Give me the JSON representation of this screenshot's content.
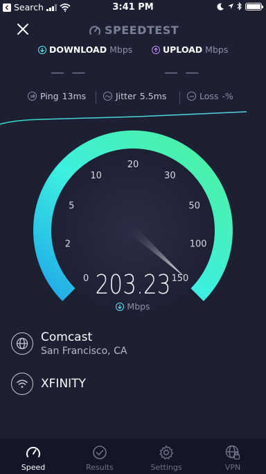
{
  "status_bar": {
    "back_label": "Search",
    "time": "3:41 PM"
  },
  "app": {
    "brand": "SPEEDTEST"
  },
  "download": {
    "label": "DOWNLOAD",
    "unit": "Mbps",
    "value": "— —",
    "color": "#5ee6f5"
  },
  "upload": {
    "label": "UPLOAD",
    "unit": "Mbps",
    "value": "— —",
    "color": "#c08cf5"
  },
  "stats": {
    "ping_label": "Ping",
    "ping_value": "13ms",
    "jitter_label": "Jitter",
    "jitter_value": "5.5ms",
    "loss_label": "Loss",
    "loss_value": "-%"
  },
  "gauge": {
    "ticks": [
      "0",
      "2",
      "5",
      "10",
      "20",
      "30",
      "50",
      "100",
      "150"
    ],
    "current_value": "203.23",
    "unit": "Mbps",
    "gradient_start": "#1fa8e8",
    "gradient_mid": "#3df0e0",
    "gradient_end": "#4ff09a"
  },
  "provider": {
    "name": "Comcast",
    "location": "San Francisco, CA"
  },
  "network": {
    "name": "XFINITY"
  },
  "tabs": [
    {
      "label": "Speed",
      "icon": "speedometer-icon",
      "active": true
    },
    {
      "label": "Results",
      "icon": "checkmark-circle-icon",
      "active": false
    },
    {
      "label": "Settings",
      "icon": "gear-icon",
      "active": false
    },
    {
      "label": "VPN",
      "icon": "globe-lock-icon",
      "active": false
    }
  ]
}
